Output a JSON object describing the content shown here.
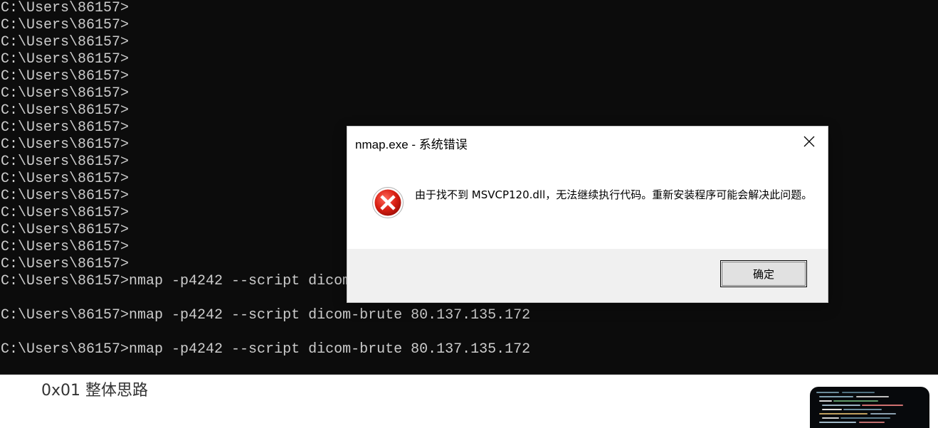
{
  "console": {
    "lines": [
      "C:\\Users\\86157>",
      "C:\\Users\\86157>",
      "C:\\Users\\86157>",
      "C:\\Users\\86157>",
      "C:\\Users\\86157>",
      "C:\\Users\\86157>",
      "C:\\Users\\86157>",
      "C:\\Users\\86157>",
      "C:\\Users\\86157>",
      "C:\\Users\\86157>",
      "C:\\Users\\86157>",
      "C:\\Users\\86157>",
      "C:\\Users\\86157>",
      "C:\\Users\\86157>",
      "C:\\Users\\86157>",
      "C:\\Users\\86157>",
      "C:\\Users\\86157>nmap -p4242 --script dicom-brute 80.137.135.172",
      "",
      "C:\\Users\\86157>nmap -p4242 --script dicom-brute 80.137.135.172",
      "",
      "C:\\Users\\86157>nmap -p4242 --script dicom-brute 80.137.135.172"
    ]
  },
  "dialog": {
    "title": "nmap.exe - 系统错误",
    "message": "由于找不到 MSVCP120.dll，无法继续执行代码。重新安装程序可能会解决此问题。",
    "ok_label": "确定",
    "icon": "error-icon"
  },
  "page": {
    "section_heading": "0x01 整体思路",
    "thumbnail_icon": "code-thumbnail-icon"
  }
}
